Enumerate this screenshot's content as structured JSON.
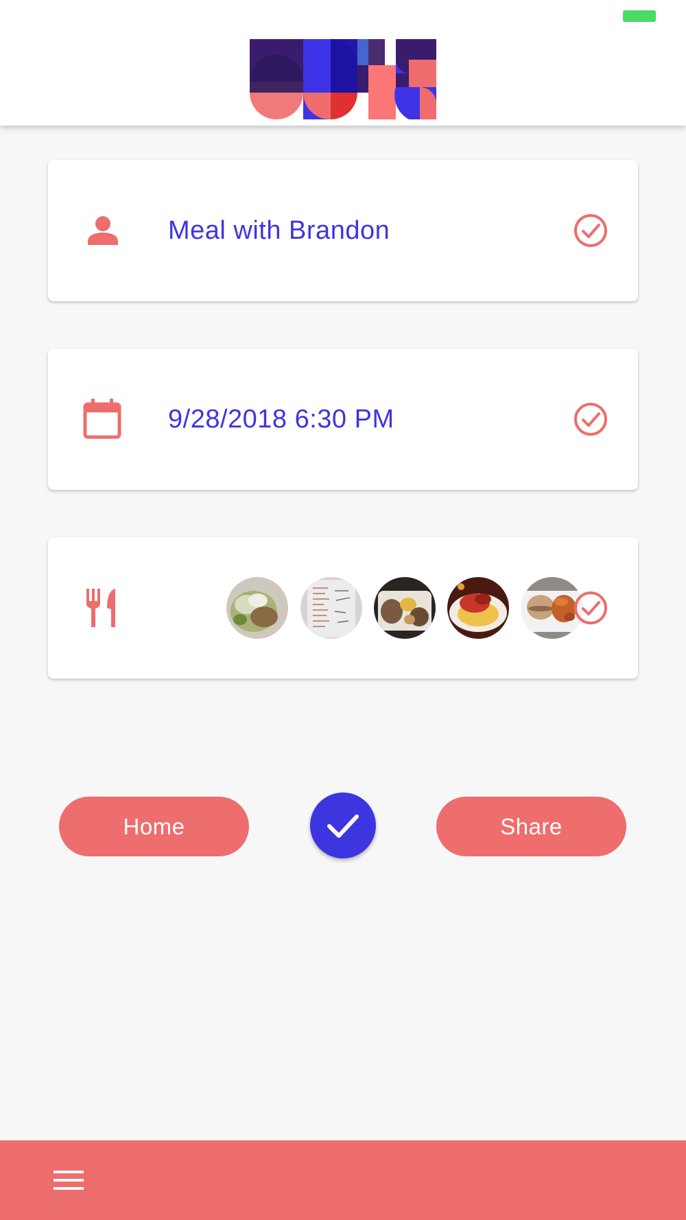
{
  "colors": {
    "accent_red": "#ee6d6d",
    "accent_blue": "#3d35e0",
    "background": "#f7f7f7",
    "card": "#ffffff",
    "status_battery": "#4cd964"
  },
  "header": {
    "logo_icon": "geometric-logo-icon",
    "battery_icon": "battery-icon"
  },
  "cards": [
    {
      "icon": "person-icon",
      "text": "Meal with Brandon",
      "status_icon": "check-circle-icon"
    },
    {
      "icon": "calendar-icon",
      "text": "9/28/2018 6:30 PM",
      "status_icon": "check-circle-icon"
    },
    {
      "icon": "fork-knife-icon",
      "status_icon": "check-circle-icon",
      "photos": [
        "tacos-photo",
        "receipt-photo",
        "takeout-platter-photo",
        "pasta-dish-photo",
        "sandwich-fries-photo"
      ]
    }
  ],
  "actions": {
    "home_label": "Home",
    "share_label": "Share",
    "confirm_icon": "check-icon"
  },
  "bottom_bar": {
    "menu_icon": "hamburger-menu-icon"
  }
}
